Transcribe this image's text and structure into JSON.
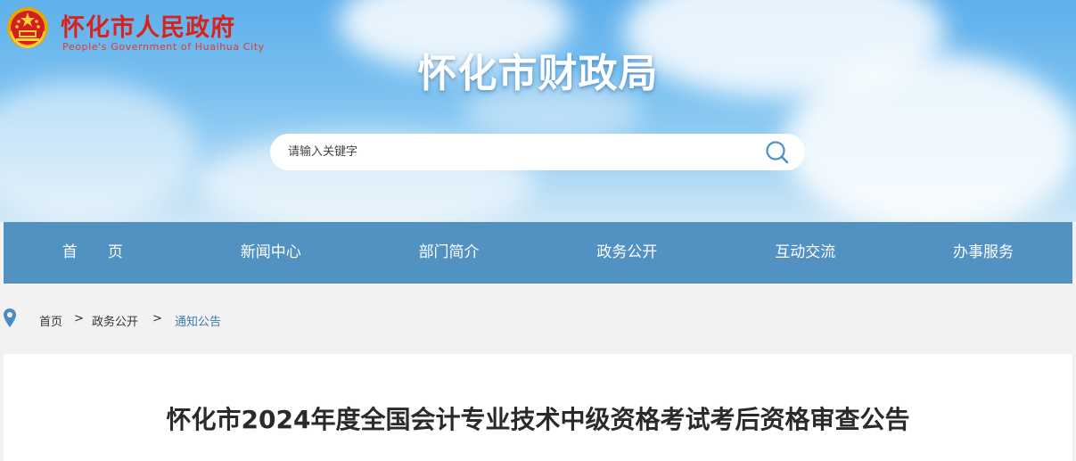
{
  "header": {
    "gov_name": "怀化市人民政府",
    "gov_name_en": "People's Government of Huaihua City",
    "site_title": "怀化市财政局",
    "search": {
      "placeholder": "请输入关键字"
    }
  },
  "nav": {
    "items": [
      {
        "label": "首　　页"
      },
      {
        "label": "新闻中心"
      },
      {
        "label": "部门简介"
      },
      {
        "label": "政务公开"
      },
      {
        "label": "互动交流"
      },
      {
        "label": "办事服务"
      }
    ]
  },
  "breadcrumb": {
    "items": [
      {
        "label": "首页"
      },
      {
        "label": "政务公开"
      },
      {
        "label": "通知公告"
      }
    ],
    "separator": ">"
  },
  "article": {
    "title": "怀化市2024年度全国会计专业技术中级资格考试考后资格审查公告"
  },
  "colors": {
    "nav_bg": "#5192c3",
    "brand_red": "#d9221c",
    "link_blue": "#3b7cb3"
  },
  "icons": [
    "national-emblem-icon",
    "search-icon",
    "location-pin-icon"
  ]
}
